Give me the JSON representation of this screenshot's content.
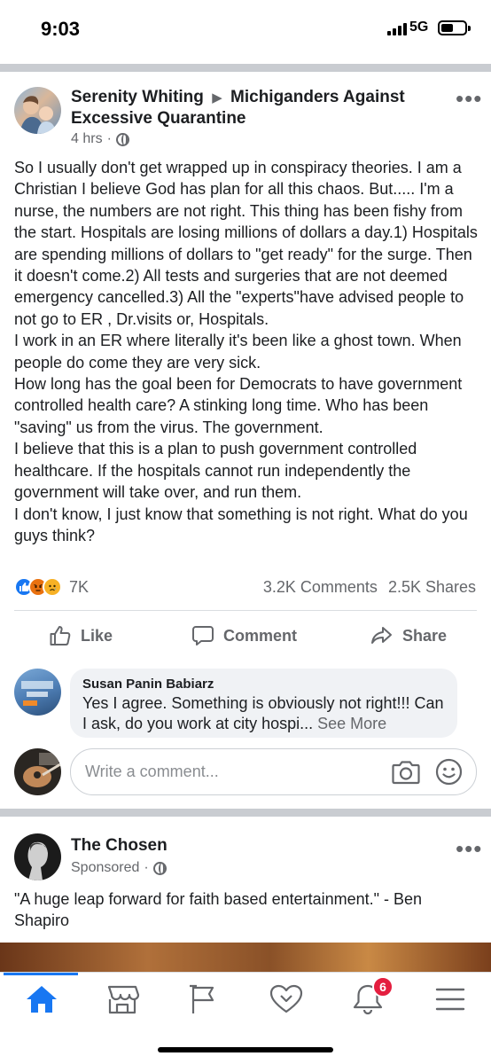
{
  "status": {
    "time": "9:03",
    "network": "5G"
  },
  "post": {
    "author": "Serenity Whiting",
    "group": "Michiganders Against Excessive Quarantine",
    "time": "4 hrs",
    "more": "•••",
    "text": "So I usually don't get wrapped up in conspiracy theories.  I am a Christian I believe God has plan for all this chaos. But..... I'm a nurse, the numbers are not right. This thing has been fishy from the start. Hospitals are losing millions of dollars a day.1) Hospitals are spending millions of dollars to \"get ready\" for the surge. Then it doesn't come.2) All tests and surgeries that are not deemed emergency cancelled.3) All the \"experts\"have advised  people to not go to ER , Dr.visits or, Hospitals.\n I work in an ER where literally it's been like a ghost town. When people do come they are very sick.\nHow long has the goal been for Democrats to have government controlled health care? A stinking long time. Who has been \"saving\" us from the virus. The government.\nI believe that this is a plan to push government controlled healthcare. If the hospitals cannot run independently the government will take over, and run them.\nI don't know, I just know that something is not right. What do you guys think?",
    "reaction_count": "7K",
    "comments_count": "3.2K Comments",
    "shares_count": "2.5K Shares",
    "actions": {
      "like": "Like",
      "comment": "Comment",
      "share": "Share"
    }
  },
  "comment": {
    "author": "Susan Panin Babiarz",
    "text": "Yes I agree. Something is obviously not right!!! Can I ask, do you work at city hospi...",
    "see_more": "See More"
  },
  "compose": {
    "placeholder": "Write a comment..."
  },
  "sponsored": {
    "name": "The Chosen",
    "label": "Sponsored",
    "more": "•••",
    "text": "\"A huge leap forward for faith based entertainment.\" - Ben Shapiro"
  },
  "tabbar": {
    "items": [
      "home-icon",
      "marketplace-icon",
      "pages-flag-icon",
      "dating-heart-icon",
      "notifications-bell-icon",
      "menu-icon"
    ],
    "notifications_badge": "6",
    "accent": "#1877f2"
  }
}
